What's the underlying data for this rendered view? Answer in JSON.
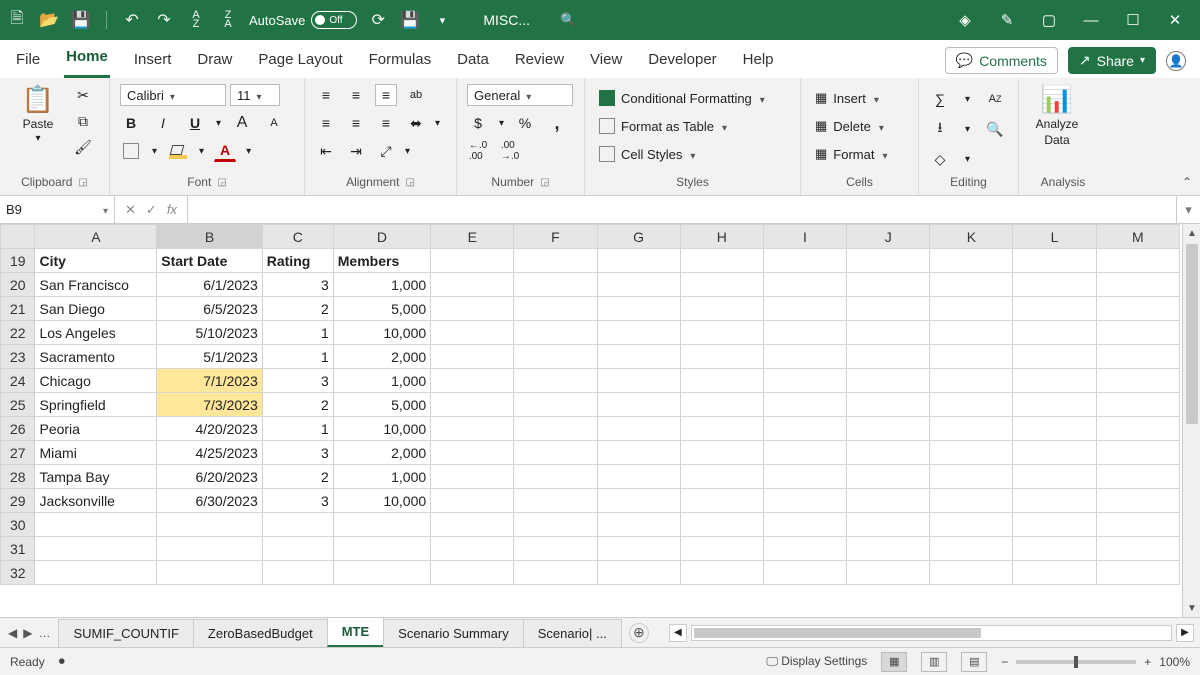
{
  "titlebar": {
    "autosave_label": "AutoSave",
    "autosave_state": "Off",
    "doc_title": "MISC...",
    "icons": {
      "new": "new-file-icon",
      "open": "open-folder-icon",
      "save": "save-icon",
      "undo": "undo-icon",
      "redo": "redo-icon",
      "sort_az": "sort-az-icon",
      "sort_za": "sort-za-icon",
      "refresh": "refresh-icon",
      "savedisk": "save-disk-icon",
      "search": "search-icon",
      "diamond": "diamond-icon",
      "wand": "wand-icon",
      "window": "window-mode-icon",
      "min": "minimize-icon",
      "max": "maximize-icon",
      "close": "close-icon"
    }
  },
  "tabs": {
    "items": [
      "File",
      "Home",
      "Insert",
      "Draw",
      "Page Layout",
      "Formulas",
      "Data",
      "Review",
      "View",
      "Developer",
      "Help"
    ],
    "active": "Home",
    "comments": "Comments",
    "share": "Share"
  },
  "ribbon": {
    "clipboard": {
      "label": "Clipboard",
      "paste": "Paste"
    },
    "font": {
      "label": "Font",
      "name": "Calibri",
      "size": "11",
      "bold": "B",
      "italic": "I",
      "underline": "U",
      "grow": "A",
      "shrink": "A"
    },
    "alignment": {
      "label": "Alignment",
      "wrap": "ab"
    },
    "number": {
      "label": "Number",
      "format": "General",
      "currency": "$",
      "percent": "%",
      "comma": ",",
      "inc": ".0",
      "dec": ".00"
    },
    "styles": {
      "label": "Styles",
      "cond": "Conditional Formatting",
      "table": "Format as Table",
      "cell": "Cell Styles"
    },
    "cells": {
      "label": "Cells",
      "insert": "Insert",
      "delete": "Delete",
      "format": "Format"
    },
    "editing": {
      "label": "Editing"
    },
    "analysis": {
      "label": "Analysis",
      "analyze": "Analyze",
      "data": "Data"
    }
  },
  "formula_bar": {
    "namebox": "B9",
    "fx": "fx",
    "value": ""
  },
  "grid": {
    "columns": [
      "A",
      "B",
      "C",
      "D",
      "E",
      "F",
      "G",
      "H",
      "I",
      "J",
      "K",
      "L",
      "M"
    ],
    "selected_col": "B",
    "row_start": 19,
    "headers": {
      "A": "City",
      "B": "Start Date",
      "C": "Rating",
      "D": "Members"
    },
    "rows": [
      {
        "r": 20,
        "A": "San Francisco",
        "B": "6/1/2023",
        "C": "3",
        "D": "1,000"
      },
      {
        "r": 21,
        "A": "San Diego",
        "B": "6/5/2023",
        "C": "2",
        "D": "5,000"
      },
      {
        "r": 22,
        "A": "Los Angeles",
        "B": "5/10/2023",
        "C": "1",
        "D": "10,000"
      },
      {
        "r": 23,
        "A": "Sacramento",
        "B": "5/1/2023",
        "C": "1",
        "D": "2,000"
      },
      {
        "r": 24,
        "A": "Chicago",
        "B": "7/1/2023",
        "C": "3",
        "D": "1,000",
        "hlB": true
      },
      {
        "r": 25,
        "A": "Springfield",
        "B": "7/3/2023",
        "C": "2",
        "D": "5,000",
        "hlB": true
      },
      {
        "r": 26,
        "A": "Peoria",
        "B": "4/20/2023",
        "C": "1",
        "D": "10,000"
      },
      {
        "r": 27,
        "A": "Miami",
        "B": "4/25/2023",
        "C": "3",
        "D": "2,000"
      },
      {
        "r": 28,
        "A": "Tampa Bay",
        "B": "6/20/2023",
        "C": "2",
        "D": "1,000"
      },
      {
        "r": 29,
        "A": "Jacksonville",
        "B": "6/30/2023",
        "C": "3",
        "D": "10,000"
      }
    ],
    "blank_rows": [
      30,
      31,
      32
    ]
  },
  "sheet_tabs": {
    "items": [
      "SUMIF_COUNTIF",
      "ZeroBasedBudget",
      "MTE",
      "Scenario Summary",
      "Scenario| ..."
    ],
    "active": "MTE"
  },
  "status": {
    "ready": "Ready",
    "display": "Display Settings",
    "zoom": "100%"
  }
}
